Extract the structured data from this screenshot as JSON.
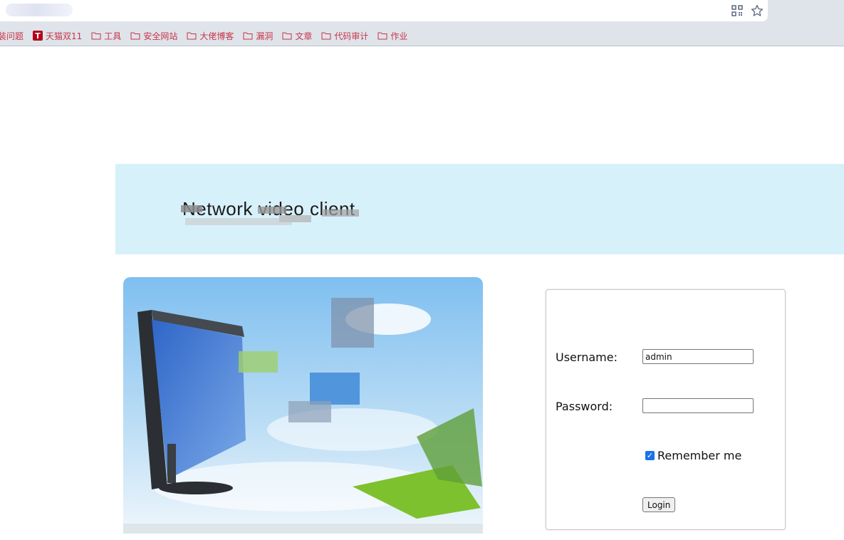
{
  "browser": {
    "bookmarks": [
      {
        "label": "装问题",
        "icon": "none"
      },
      {
        "label": "天猫双11",
        "icon": "tmall-icon"
      },
      {
        "label": "工具",
        "icon": "folder-icon"
      },
      {
        "label": "安全网站",
        "icon": "folder-icon"
      },
      {
        "label": "大佬博客",
        "icon": "folder-icon"
      },
      {
        "label": "漏洞",
        "icon": "folder-icon"
      },
      {
        "label": "文章",
        "icon": "folder-icon"
      },
      {
        "label": "代码审计",
        "icon": "folder-icon"
      },
      {
        "label": "作业",
        "icon": "folder-icon"
      }
    ],
    "tmall_glyph": "T",
    "icons": [
      "qr-code-icon",
      "bookmark-star-icon"
    ]
  },
  "banner": {
    "title": "Network video client"
  },
  "login": {
    "username_label": "Username:",
    "username_value": "admin",
    "password_label": "Password:",
    "password_value": "",
    "remember_label": "Remember me",
    "remember_checked": true,
    "login_button": "Login"
  },
  "colors": {
    "banner_bg": "#d7f1fb",
    "bookmark_text": "#c8344a",
    "checkbox": "#1a73e8"
  }
}
